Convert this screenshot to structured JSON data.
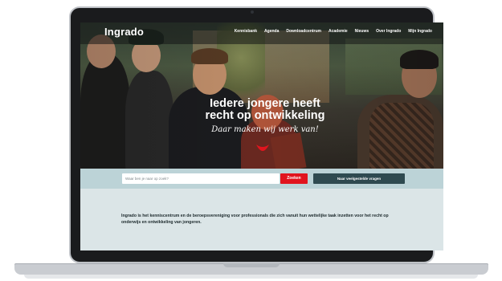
{
  "site": {
    "logo": "Ingrado",
    "nav": [
      "Kennisbank",
      "Agenda",
      "Downloadcentrum",
      "Academie",
      "Nieuws",
      "Over Ingrado",
      "Mijn Ingrado"
    ]
  },
  "hero": {
    "headline_line1": "Iedere jongere heeft",
    "headline_line2": "recht op ontwikkeling",
    "tagline": "Daar maken wij werk van!"
  },
  "search": {
    "placeholder": "Waar ben je naar op zoek?",
    "button_label": "Zoeken",
    "faq_label": "Naar veelgestelde vragen"
  },
  "intro": {
    "text": "Ingrado is het kenniscentrum en de beroepsvereniging voor professionals die zich vanuit hun wettelijke taak inzetten voor het recht op onderwijs en ontwikkeling van jongeren."
  },
  "colors": {
    "accent_red": "#e1141e",
    "dark_teal": "#2f4a50",
    "search_band": "#bcd3d7",
    "page_bg": "#dbe5e7"
  }
}
